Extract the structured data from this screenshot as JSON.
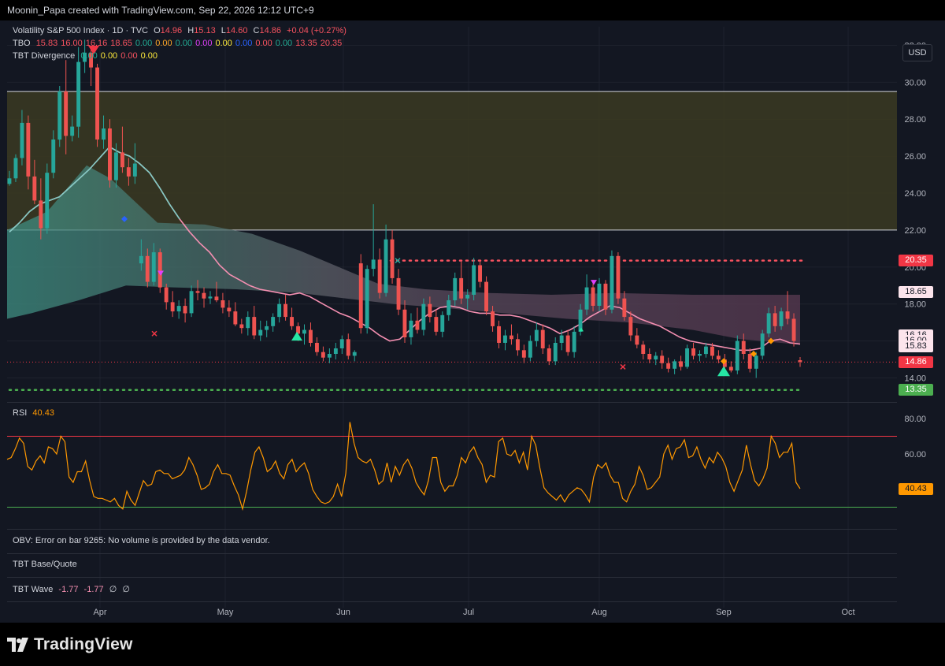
{
  "header": {
    "credit": "Moonin_Papa created with TradingView.com, Sep 22, 2026 12:12 UTC+9"
  },
  "currency_button": "USD",
  "legend": {
    "main": {
      "name": "Volatility S&P 500 Index · 1D · TVC",
      "o_label": "O",
      "o": "14.96",
      "h_label": "H",
      "h": "15.13",
      "l_label": "L",
      "l": "14.60",
      "c_label": "C",
      "c": "14.86",
      "chg": "+0.04 (+0.27%)"
    },
    "tbo": {
      "name": "TBO",
      "values": [
        "15.83",
        "16.00",
        "16.16",
        "18.65",
        "0.00",
        "0.00",
        "0.00",
        "0.00",
        "0.00",
        "0.00",
        "0.00",
        "0.00",
        "13.35",
        "20.35"
      ],
      "colors": [
        "#f7525f",
        "#f7525f",
        "#f7525f",
        "#f7525f",
        "#22ab94",
        "#ffa726",
        "#22ab94",
        "#e040fb",
        "#ffeb3b",
        "#2962ff",
        "#f7525f",
        "#22ab94",
        "#f7525f",
        "#f7525f"
      ]
    },
    "div": {
      "name": "TBT Divergence",
      "values": [
        "0.00",
        "0.00",
        "0.00",
        "0.00"
      ],
      "colors": [
        "#22ab94",
        "#ffeb3b",
        "#f7525f",
        "#ffeb3b"
      ]
    },
    "rsi": {
      "name": "RSI",
      "value": "40.43"
    },
    "obv": {
      "text": "OBV: Error on bar 9265: No volume is provided by the data vendor."
    },
    "base_quote": {
      "name": "TBT Base/Quote"
    },
    "wave": {
      "name": "TBT Wave",
      "v1": "-1.77",
      "v2": "-1.77",
      "v3": "∅",
      "v4": "∅"
    }
  },
  "price_tags": [
    {
      "label": "20.35",
      "bg": "#f23645",
      "fg": "#ffffff",
      "value": 20.35
    },
    {
      "label": "18.65",
      "bg": "#fce4ec",
      "fg": "#131722",
      "value": 18.65
    },
    {
      "label": "16.16",
      "bg": "#fce4ec",
      "fg": "#131722",
      "value": 16.16
    },
    {
      "label": "16.00",
      "bg": "#fce4ec",
      "fg": "#131722",
      "value": 16.0
    },
    {
      "label": "15.83",
      "bg": "#fce4ec",
      "fg": "#131722",
      "value": 15.83
    },
    {
      "label": "14.86",
      "bg": "#f23645",
      "fg": "#ffffff",
      "value": 14.86
    },
    {
      "label": "13.35",
      "bg": "#4caf50",
      "fg": "#ffffff",
      "value": 13.35
    },
    {
      "label": "40.43",
      "bg": "#ff9800",
      "fg": "#131722",
      "value": 40.43
    }
  ],
  "colors": {
    "up": "#26a69a",
    "down": "#ef5350",
    "rsi": "#ff9800",
    "band_fill": "#3b3a22",
    "upper_level": "#f7525f",
    "lower_level": "#4caf50",
    "ma": "#f48fb1",
    "ma_early": "#80cbc4"
  },
  "chart_data": [
    {
      "type": "candlestick",
      "title": "Volatility S&P 500 Index · 1D · TVC",
      "x_ticks": [
        "Apr",
        "May",
        "Jun",
        "Jul",
        "Aug",
        "Sep",
        "Oct"
      ],
      "y_ticks": [
        "32.00",
        "30.00",
        "28.00",
        "26.00",
        "24.00",
        "22.00",
        "20.00",
        "18.00",
        "16.00",
        "14.00",
        "13.35"
      ],
      "ylim": [
        12.7,
        33.0
      ],
      "candles": [
        [
          24.5,
          25.2,
          24.4,
          24.8
        ],
        [
          24.8,
          26.1,
          24.6,
          25.9
        ],
        [
          25.9,
          28.5,
          25.5,
          27.8
        ],
        [
          27.8,
          28.2,
          24.2,
          24.9
        ],
        [
          24.9,
          25.8,
          23.4,
          23.6
        ],
        [
          23.6,
          24.8,
          21.5,
          22.1
        ],
        [
          22.1,
          25.6,
          21.8,
          25.1
        ],
        [
          25.1,
          27.4,
          24.8,
          26.9
        ],
        [
          26.9,
          29.8,
          26.5,
          29.5
        ],
        [
          29.5,
          31.2,
          26.1,
          27.1
        ],
        [
          27.1,
          28.2,
          26.8,
          27.6
        ],
        [
          27.6,
          31.9,
          27.0,
          31.1
        ],
        [
          31.1,
          32.3,
          30.5,
          31.6
        ],
        [
          31.6,
          31.9,
          29.8,
          30.8
        ],
        [
          30.8,
          31.0,
          26.5,
          26.9
        ],
        [
          26.9,
          28.2,
          26.4,
          27.5
        ],
        [
          27.5,
          28.0,
          24.3,
          24.7
        ],
        [
          24.7,
          26.7,
          24.3,
          26.2
        ],
        [
          26.2,
          27.6,
          25.1,
          25.4
        ],
        [
          25.4,
          25.9,
          24.4,
          24.9
        ],
        [
          24.9,
          26.7,
          24.5,
          25.6
        ],
        [
          20.2,
          21.5,
          19.8,
          20.6
        ],
        [
          20.6,
          21.0,
          18.9,
          19.2
        ],
        [
          19.2,
          21.3,
          19.0,
          20.8
        ],
        [
          20.8,
          21.0,
          18.6,
          18.9
        ],
        [
          18.9,
          19.1,
          17.7,
          18.1
        ],
        [
          18.1,
          18.7,
          17.3,
          17.6
        ],
        [
          17.6,
          18.2,
          17.2,
          17.9
        ],
        [
          17.9,
          18.3,
          17.0,
          17.5
        ],
        [
          17.5,
          19.0,
          17.3,
          18.7
        ],
        [
          18.7,
          19.3,
          18.2,
          18.6
        ],
        [
          18.6,
          18.9,
          17.8,
          18.3
        ],
        [
          18.3,
          18.7,
          18.0,
          18.4
        ],
        [
          18.4,
          19.2,
          18.1,
          18.2
        ],
        [
          18.2,
          18.6,
          17.5,
          17.8
        ],
        [
          17.8,
          18.2,
          17.3,
          17.6
        ],
        [
          17.6,
          18.1,
          16.8,
          16.9
        ],
        [
          16.9,
          17.2,
          16.4,
          16.7
        ],
        [
          16.7,
          17.6,
          16.3,
          17.3
        ],
        [
          17.3,
          17.9,
          16.1,
          16.3
        ],
        [
          16.3,
          17.1,
          16.0,
          16.6
        ],
        [
          16.6,
          17.1,
          16.2,
          16.8
        ],
        [
          16.8,
          17.5,
          16.5,
          17.3
        ],
        [
          17.3,
          18.3,
          17.0,
          18.0
        ],
        [
          18.0,
          18.5,
          17.1,
          17.3
        ],
        [
          17.3,
          17.8,
          16.6,
          16.8
        ],
        [
          16.8,
          17.0,
          16.0,
          16.4
        ],
        [
          16.4,
          16.9,
          15.8,
          16.6
        ],
        [
          16.6,
          17.0,
          15.7,
          15.9
        ],
        [
          15.9,
          16.2,
          15.2,
          15.4
        ],
        [
          15.4,
          15.7,
          14.9,
          15.1
        ],
        [
          15.1,
          15.6,
          14.8,
          15.3
        ],
        [
          15.3,
          15.9,
          15.0,
          15.6
        ],
        [
          15.6,
          16.3,
          15.3,
          16.1
        ],
        [
          16.1,
          16.4,
          15.0,
          15.2
        ],
        [
          15.2,
          15.5,
          14.9,
          15.4
        ],
        [
          20.2,
          20.7,
          16.4,
          16.7
        ],
        [
          16.7,
          20.1,
          16.4,
          19.9
        ],
        [
          19.9,
          23.4,
          19.5,
          20.4
        ],
        [
          20.4,
          21.0,
          18.3,
          18.6
        ],
        [
          18.6,
          22.3,
          18.4,
          21.5
        ],
        [
          21.5,
          22.0,
          19.1,
          19.4
        ],
        [
          19.4,
          19.9,
          17.4,
          17.7
        ],
        [
          17.7,
          18.2,
          15.9,
          16.2
        ],
        [
          16.2,
          17.5,
          15.8,
          17.1
        ],
        [
          17.1,
          17.8,
          16.4,
          16.6
        ],
        [
          16.6,
          18.3,
          16.3,
          18.0
        ],
        [
          18.0,
          18.4,
          17.0,
          17.3
        ],
        [
          17.3,
          17.7,
          16.3,
          16.5
        ],
        [
          16.5,
          17.6,
          16.2,
          17.4
        ],
        [
          17.4,
          18.5,
          17.1,
          18.2
        ],
        [
          18.2,
          19.7,
          17.9,
          19.4
        ],
        [
          19.4,
          20.3,
          18.0,
          18.3
        ],
        [
          18.3,
          18.8,
          17.7,
          18.5
        ],
        [
          18.5,
          20.5,
          18.2,
          20.1
        ],
        [
          20.1,
          20.4,
          18.9,
          19.2
        ],
        [
          19.2,
          19.5,
          17.4,
          17.6
        ],
        [
          17.6,
          17.9,
          16.5,
          16.8
        ],
        [
          16.8,
          17.1,
          15.6,
          15.9
        ],
        [
          15.9,
          16.6,
          15.5,
          16.3
        ],
        [
          16.3,
          16.9,
          15.8,
          16.1
        ],
        [
          16.1,
          16.4,
          15.2,
          15.5
        ],
        [
          15.5,
          15.8,
          14.8,
          15.1
        ],
        [
          15.1,
          16.3,
          14.9,
          16.0
        ],
        [
          16.0,
          17.0,
          15.7,
          16.6
        ],
        [
          16.6,
          16.9,
          15.3,
          15.6
        ],
        [
          15.6,
          15.8,
          14.7,
          14.9
        ],
        [
          14.9,
          16.2,
          14.7,
          15.9
        ],
        [
          15.9,
          16.6,
          15.5,
          16.3
        ],
        [
          16.3,
          16.6,
          15.2,
          15.4
        ],
        [
          15.4,
          16.8,
          15.1,
          16.5
        ],
        [
          16.5,
          18.0,
          16.3,
          17.7
        ],
        [
          17.7,
          19.6,
          17.4,
          18.9
        ],
        [
          18.9,
          19.3,
          17.6,
          17.9
        ],
        [
          17.9,
          19.4,
          17.6,
          19.1
        ],
        [
          19.1,
          19.3,
          17.4,
          17.7
        ],
        [
          17.7,
          20.9,
          17.5,
          20.6
        ],
        [
          20.6,
          20.8,
          18.0,
          18.3
        ],
        [
          18.3,
          18.7,
          17.1,
          17.3
        ],
        [
          17.3,
          17.6,
          16.0,
          16.3
        ],
        [
          16.3,
          16.7,
          15.6,
          15.8
        ],
        [
          15.8,
          16.0,
          15.0,
          15.3
        ],
        [
          15.3,
          15.6,
          14.8,
          15.0
        ],
        [
          15.0,
          15.4,
          14.7,
          15.2
        ],
        [
          15.2,
          15.5,
          14.5,
          14.8
        ],
        [
          14.8,
          15.1,
          14.3,
          14.5
        ],
        [
          14.5,
          15.0,
          14.2,
          14.9
        ],
        [
          14.9,
          15.2,
          14.4,
          14.6
        ],
        [
          14.6,
          15.8,
          14.5,
          15.6
        ],
        [
          15.6,
          15.9,
          15.0,
          15.2
        ],
        [
          15.2,
          15.5,
          14.9,
          15.3
        ],
        [
          15.3,
          15.9,
          15.1,
          15.7
        ],
        [
          15.7,
          15.9,
          15.0,
          15.2
        ],
        [
          15.2,
          15.5,
          14.8,
          15.0
        ],
        [
          15.0,
          15.3,
          14.4,
          14.6
        ],
        [
          14.6,
          14.9,
          14.3,
          14.4
        ],
        [
          14.4,
          16.3,
          14.2,
          16.0
        ],
        [
          16.0,
          16.4,
          15.0,
          15.3
        ],
        [
          15.3,
          15.6,
          14.3,
          14.5
        ],
        [
          14.5,
          15.4,
          14.0,
          15.2
        ],
        [
          15.2,
          16.6,
          15.0,
          16.4
        ],
        [
          16.4,
          17.8,
          16.2,
          17.5
        ],
        [
          17.5,
          17.9,
          16.5,
          16.8
        ],
        [
          16.8,
          17.8,
          16.6,
          17.6
        ],
        [
          17.6,
          18.7,
          16.9,
          17.2
        ],
        [
          17.2,
          17.5,
          15.7,
          16.0
        ],
        [
          14.96,
          15.13,
          14.6,
          14.86
        ]
      ],
      "ma": [
        21.9,
        22.4,
        23.0,
        23.4,
        23.6,
        23.8,
        24.3,
        24.8,
        25.3,
        25.9,
        26.5,
        26.2,
        26.0,
        25.6,
        25.1,
        24.3,
        23.4,
        22.6,
        21.9,
        21.3,
        20.8,
        20.1,
        19.6,
        19.3,
        19.0,
        18.8,
        18.7,
        18.6,
        18.5,
        18.6,
        18.4,
        18.1,
        17.8,
        17.5,
        17.3,
        17.0,
        16.7,
        16.3,
        16.0,
        16.1,
        16.6,
        17.1,
        17.5,
        17.8,
        17.9,
        17.8,
        17.6,
        17.5,
        17.5,
        17.4,
        17.4,
        17.3,
        17.1,
        16.9,
        16.7,
        16.4,
        16.6,
        16.9,
        17.3,
        17.6,
        17.9,
        17.8,
        17.5,
        17.2,
        17.0,
        16.8,
        16.5,
        16.2,
        16.0,
        15.9,
        15.8,
        15.7,
        15.6,
        15.5,
        15.5,
        15.6,
        16.0,
        16.1,
        15.9,
        15.83
      ],
      "rsi": {
        "type": "line",
        "ylim": [
          20,
          84
        ],
        "levels": [
          70,
          30
        ],
        "y_ticks": [
          "80.00",
          "60.00"
        ],
        "values": [
          57,
          58,
          63,
          69,
          66,
          53,
          51,
          56,
          59,
          55,
          64,
          63,
          60,
          70,
          67,
          47,
          44,
          50,
          50,
          56,
          45,
          36,
          35,
          35,
          34,
          33,
          35,
          31,
          29,
          39,
          34,
          31,
          38,
          45,
          42,
          43,
          50,
          51,
          49,
          49,
          46,
          47,
          48,
          51,
          58,
          54,
          48,
          40,
          41,
          43,
          50,
          54,
          49,
          49,
          48,
          42,
          37,
          29,
          39,
          51,
          61,
          64,
          58,
          50,
          52,
          56,
          49,
          46,
          54,
          57,
          50,
          53,
          55,
          49,
          40,
          36,
          33,
          32,
          33,
          36,
          43,
          36,
          49,
          78,
          66,
          58,
          56,
          55,
          57,
          51,
          43,
          45,
          55,
          44,
          53,
          48,
          54,
          57,
          52,
          44,
          40,
          37,
          45,
          58,
          58,
          44,
          39,
          42,
          42,
          48,
          58,
          55,
          61,
          64,
          58,
          54,
          44,
          48,
          47,
          67,
          69,
          60,
          59,
          62,
          55,
          61,
          51,
          70,
          65,
          52,
          41,
          38,
          36,
          34,
          37,
          33,
          37,
          39,
          41,
          40,
          37,
          33,
          47,
          54,
          52,
          55,
          48,
          44,
          44,
          35,
          33,
          39,
          43,
          53,
          48,
          40,
          41,
          44,
          47,
          60,
          65,
          57,
          63,
          64,
          68,
          58,
          59,
          64,
          57,
          52,
          58,
          55,
          61,
          58,
          53,
          44,
          39,
          45,
          51,
          65,
          54,
          45,
          42,
          46,
          52,
          70,
          66,
          58,
          61,
          61,
          66,
          44,
          40.43
        ]
      }
    }
  ]
}
